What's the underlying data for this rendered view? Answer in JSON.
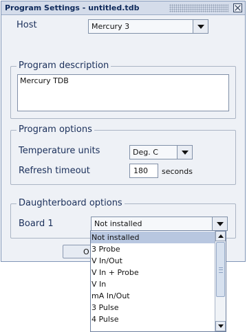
{
  "window": {
    "title": "Program Settings - untitled.tdb"
  },
  "host": {
    "label": "Host",
    "value": "Mercury 3"
  },
  "description": {
    "legend": "Program description",
    "text": "Mercury TDB"
  },
  "options": {
    "legend": "Program options",
    "temp_label": "Temperature units",
    "temp_value": "Deg. C",
    "refresh_label": "Refresh timeout",
    "refresh_value": "180",
    "refresh_unit": "seconds"
  },
  "daughter": {
    "legend": "Daughterboard options",
    "board_label": "Board 1",
    "board_value": "Not installed"
  },
  "ok_button": {
    "label": "O"
  },
  "dropdown": {
    "items": [
      "Not installed",
      "3 Probe",
      "V In/Out",
      "V In + Probe",
      "V In",
      "mA In/Out",
      "3 Pulse",
      "4 Pulse"
    ],
    "selected_index": 0
  },
  "colors": {
    "accent": "#b8c7e0",
    "dialog_bg": "#eef1f6",
    "text": "#1a2f5a"
  },
  "icons": {
    "close": "close-icon",
    "dropdown": "chevron-down-icon",
    "scroll_up": "scroll-up-icon",
    "scroll_down": "scroll-down-icon"
  }
}
